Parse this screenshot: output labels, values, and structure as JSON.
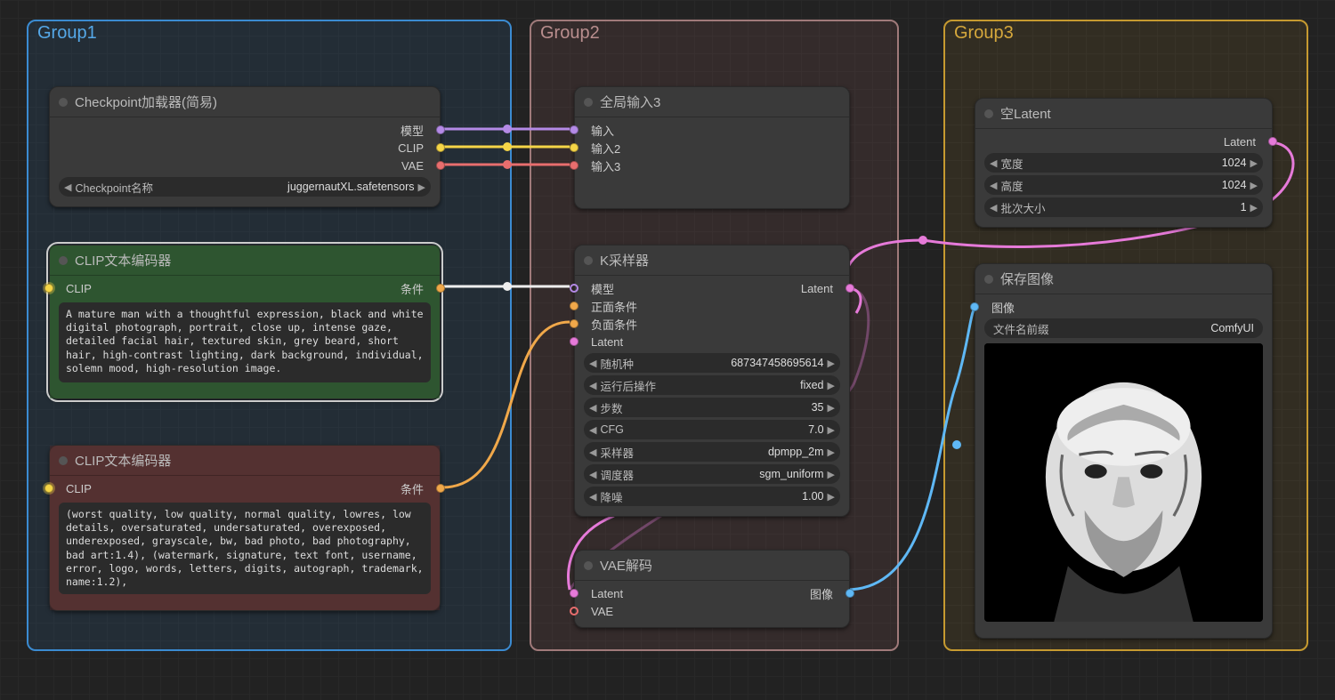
{
  "groups": {
    "g1": {
      "title": "Group1"
    },
    "g2": {
      "title": "Group2"
    },
    "g3": {
      "title": "Group3"
    }
  },
  "nodes": {
    "checkpoint": {
      "title": "Checkpoint加载器(简易)",
      "outs": {
        "model": "模型",
        "clip": "CLIP",
        "vae": "VAE"
      },
      "param": {
        "label": "Checkpoint名称",
        "value": "juggernautXL.safetensors"
      }
    },
    "clip_pos": {
      "title": "CLIP文本编码器",
      "in_clip": "CLIP",
      "out_cond": "条件",
      "text": "A mature man with a thoughtful expression, black and white digital photograph, portrait, close up, intense gaze, detailed facial hair, textured skin, grey beard, short hair, high-contrast lighting, dark background, individual, solemn mood, high-resolution image."
    },
    "clip_neg": {
      "title": "CLIP文本编码器",
      "in_clip": "CLIP",
      "out_cond": "条件",
      "text": "(worst quality, low quality, normal quality, lowres, low details, oversaturated, undersaturated, overexposed, underexposed, grayscale, bw, bad photo, bad photography, bad art:1.4), (watermark, signature, text font, username, error, logo, words, letters, digits, autograph, trademark, name:1.2),"
    },
    "globals": {
      "title": "全局输入3",
      "ins": {
        "a": "输入",
        "b": "输入2",
        "c": "输入3"
      }
    },
    "ksampler": {
      "title": "K采样器",
      "ins": {
        "model": "模型",
        "pos": "正面条件",
        "neg": "负面条件",
        "latent": "Latent"
      },
      "out_latent": "Latent",
      "params": [
        {
          "label": "随机种",
          "value": "687347458695614"
        },
        {
          "label": "运行后操作",
          "value": "fixed"
        },
        {
          "label": "步数",
          "value": "35"
        },
        {
          "label": "CFG",
          "value": "7.0"
        },
        {
          "label": "采样器",
          "value": "dpmpp_2m"
        },
        {
          "label": "调度器",
          "value": "sgm_uniform"
        },
        {
          "label": "降噪",
          "value": "1.00"
        }
      ]
    },
    "vae_decode": {
      "title": "VAE解码",
      "ins": {
        "latent": "Latent",
        "vae": "VAE"
      },
      "out_image": "图像"
    },
    "empty_latent": {
      "title": "空Latent",
      "out": "Latent",
      "params": [
        {
          "label": "宽度",
          "value": "1024"
        },
        {
          "label": "高度",
          "value": "1024"
        },
        {
          "label": "批次大小",
          "value": "1"
        }
      ]
    },
    "save_image": {
      "title": "保存图像",
      "in_image": "图像",
      "param": {
        "label": "文件名前缀",
        "value": "ComfyUI"
      }
    }
  },
  "colors": {
    "model": "#b48ae6",
    "clip": "#f5d547",
    "vae": "#e86e6e",
    "cond": "#f0a84a",
    "latent": "#e67ad9",
    "image": "#5fb8f5",
    "white": "#eeeeee"
  }
}
